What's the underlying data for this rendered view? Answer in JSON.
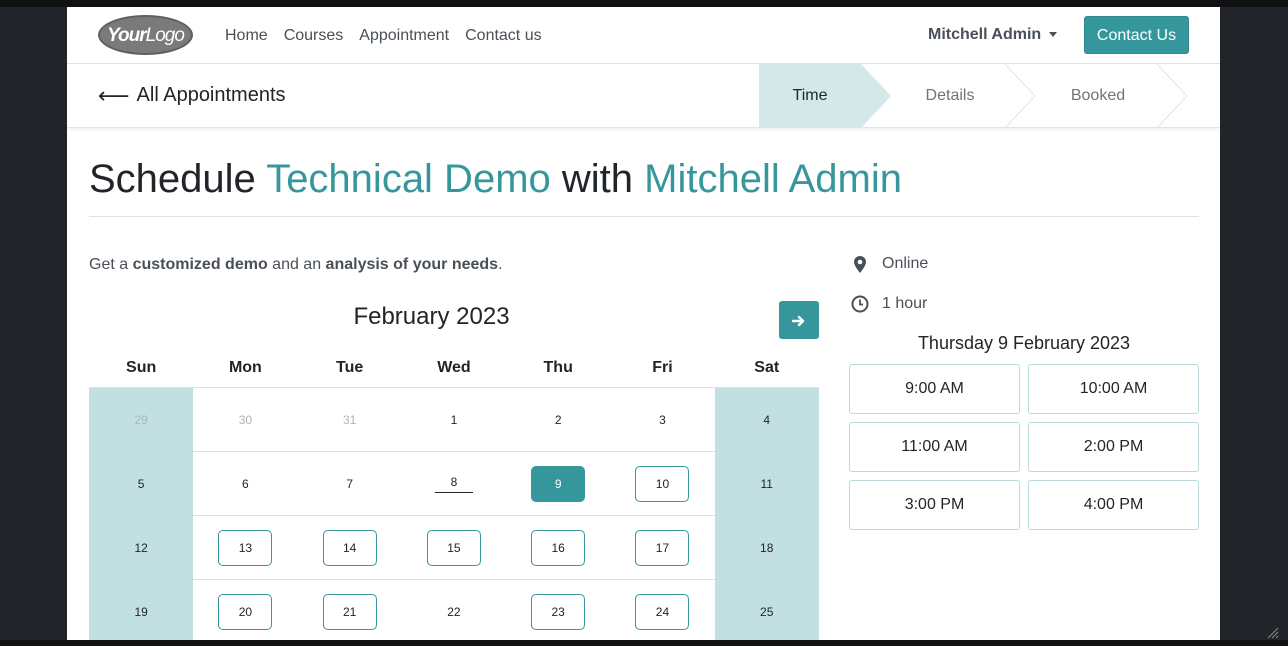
{
  "nav": {
    "logo_text_bold": "Your",
    "logo_text_light": "Logo",
    "links": [
      "Home",
      "Courses",
      "Appointment",
      "Contact us"
    ],
    "user": "Mitchell Admin",
    "cta": "Contact Us"
  },
  "breadcrumb": {
    "back_label": "All Appointments",
    "steps": [
      "Time",
      "Details",
      "Booked"
    ],
    "active_step": "Time"
  },
  "title": {
    "prefix": "Schedule ",
    "appointment": "Technical Demo",
    "middle": " with ",
    "staff": "Mitchell Admin"
  },
  "description": {
    "p1": "Get a ",
    "b1": "customized demo",
    "p2": " and an ",
    "b2": "analysis of your needs",
    "p3": "."
  },
  "calendar": {
    "month_label": "February 2023",
    "weekdays": [
      "Sun",
      "Mon",
      "Tue",
      "Wed",
      "Thu",
      "Fri",
      "Sat"
    ],
    "weeks": [
      [
        {
          "d": "29",
          "s": "muted"
        },
        {
          "d": "30",
          "s": "muted"
        },
        {
          "d": "31",
          "s": "muted"
        },
        {
          "d": "1",
          "s": ""
        },
        {
          "d": "2",
          "s": ""
        },
        {
          "d": "3",
          "s": ""
        },
        {
          "d": "4",
          "s": ""
        }
      ],
      [
        {
          "d": "5",
          "s": ""
        },
        {
          "d": "6",
          "s": ""
        },
        {
          "d": "7",
          "s": ""
        },
        {
          "d": "8",
          "s": "today"
        },
        {
          "d": "9",
          "s": "selected"
        },
        {
          "d": "10",
          "s": "available"
        },
        {
          "d": "11",
          "s": ""
        }
      ],
      [
        {
          "d": "12",
          "s": ""
        },
        {
          "d": "13",
          "s": "available"
        },
        {
          "d": "14",
          "s": "available"
        },
        {
          "d": "15",
          "s": "available"
        },
        {
          "d": "16",
          "s": "available"
        },
        {
          "d": "17",
          "s": "available"
        },
        {
          "d": "18",
          "s": ""
        }
      ],
      [
        {
          "d": "19",
          "s": ""
        },
        {
          "d": "20",
          "s": "available"
        },
        {
          "d": "21",
          "s": "available"
        },
        {
          "d": "22",
          "s": ""
        },
        {
          "d": "23",
          "s": "available"
        },
        {
          "d": "24",
          "s": "available"
        },
        {
          "d": "25",
          "s": ""
        }
      ]
    ]
  },
  "details": {
    "location": "Online",
    "duration": "1 hour",
    "selected_date": "Thursday 9 February 2023",
    "slots": [
      "9:00 AM",
      "10:00 AM",
      "11:00 AM",
      "2:00 PM",
      "3:00 PM",
      "4:00 PM"
    ]
  },
  "colors": {
    "accent": "#35979c",
    "weekend_bg": "#c2e0e1"
  }
}
